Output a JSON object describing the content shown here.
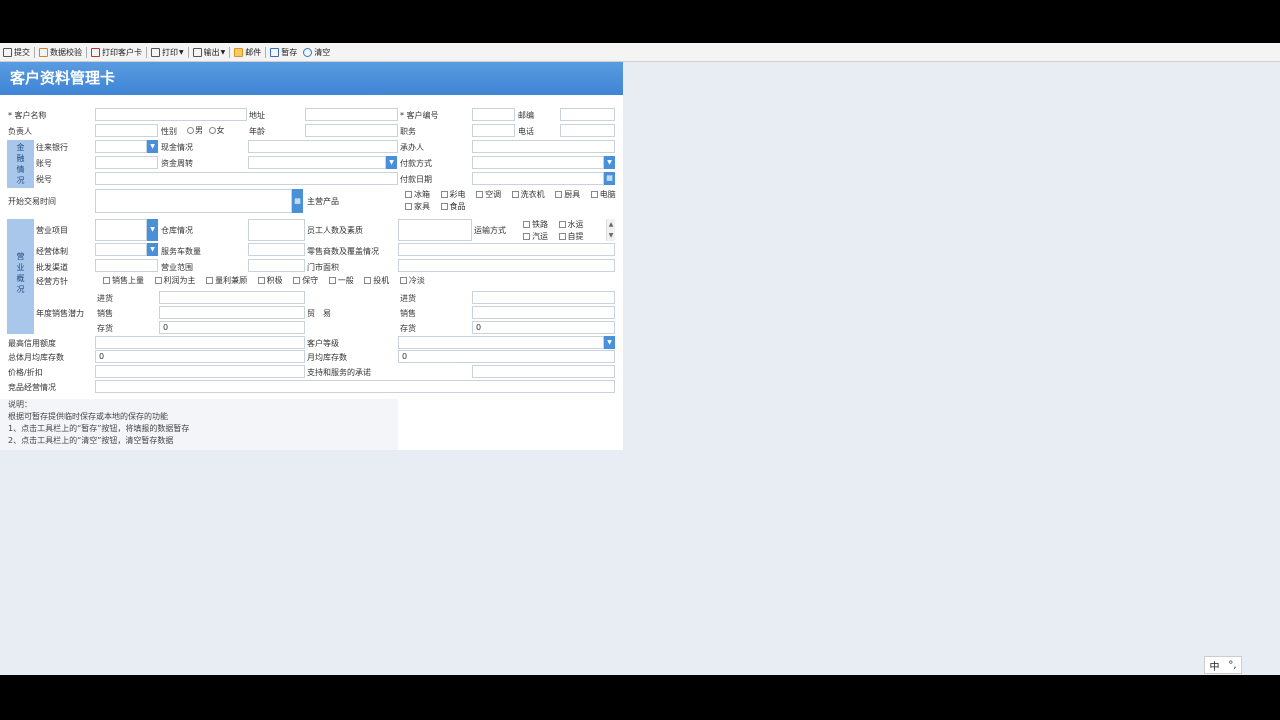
{
  "toolbar": {
    "items": [
      {
        "label": "提交",
        "icon": "submit-icon"
      },
      {
        "label": "数据校验",
        "icon": "validate-icon"
      },
      {
        "label": "打印客户卡",
        "icon": "print-card-icon"
      },
      {
        "label": "打印",
        "icon": "print-icon"
      },
      {
        "label": "输出",
        "icon": "export-icon"
      },
      {
        "label": "邮件",
        "icon": "mail-icon"
      },
      {
        "label": "暂存",
        "icon": "save-draft-icon"
      },
      {
        "label": "清空",
        "icon": "clear-icon"
      }
    ]
  },
  "form": {
    "title": "客户资料管理卡",
    "labels": {
      "customer_name": "* 客户名称",
      "address": "地址",
      "customer_no": "* 客户编号",
      "postcode": "邮编",
      "manager": "负责人",
      "gender": "性别",
      "male": "男",
      "female": "女",
      "age": "年龄",
      "position": "职务",
      "phone": "电话",
      "finance_side": "金融情况",
      "bank": "往来银行",
      "fund_status": "现金情况",
      "handler": "承办人",
      "account": "账号",
      "fund_turnover": "资金周转",
      "payment_method": "付款方式",
      "tax_no": "税号",
      "payment_date": "付款日期",
      "start_time": "开始交易时间",
      "main_products": "主营产品",
      "business_side": "营业概况",
      "business_items": "营业项目",
      "warehouse": "仓库情况",
      "staff": "员工人数及素质",
      "transport": "运输方式",
      "operation_type": "经营体制",
      "service_vehicles": "服务车数量",
      "retail_coverage": "零售商数及覆盖情况",
      "wholesale": "批发渠道",
      "business_area": "营业范围",
      "store_area": "门市面积",
      "policy": "经营方针",
      "sales_potential": "年度销售潜力",
      "purchase": "进货",
      "sales": "销售",
      "stock": "存货",
      "purchase2": "进货",
      "sales2": "销售",
      "stock2": "存货",
      "trade": "贸　易",
      "max_credit": "最高信用额度",
      "customer_level": "客户等级",
      "monthly_stock": "总体月均库存数",
      "monthly_avg_stock": "月均库存数",
      "price_discount": "价格/折扣",
      "support": "支持和服务的承诺",
      "competitor": "竞品经营情况"
    },
    "products": [
      "冰箱",
      "彩电",
      "空调",
      "洗衣机",
      "厨具",
      "电脑",
      "家具",
      "食品"
    ],
    "transport_options": [
      "铁路",
      "水运",
      "汽运",
      "自提"
    ],
    "policy_options": [
      "销售上量",
      "利润为主",
      "量利兼顾",
      "积极",
      "保守",
      "一般",
      "投机",
      "冷淡"
    ],
    "values": {
      "stock_1": "0",
      "stock_2": "0",
      "monthly_stock": "0",
      "monthly_avg_stock": "0"
    }
  },
  "notes": {
    "heading": "说明：",
    "line1": "根据可暂存提供临时保存或本地的保存的功能",
    "line2": "1、点击工具栏上的“暂存”按钮，将填报的数据暂存",
    "line3": "2、点击工具栏上的“清空”按钮，清空暂存数据"
  },
  "ime": {
    "lang": "中",
    "mode": "°,"
  }
}
